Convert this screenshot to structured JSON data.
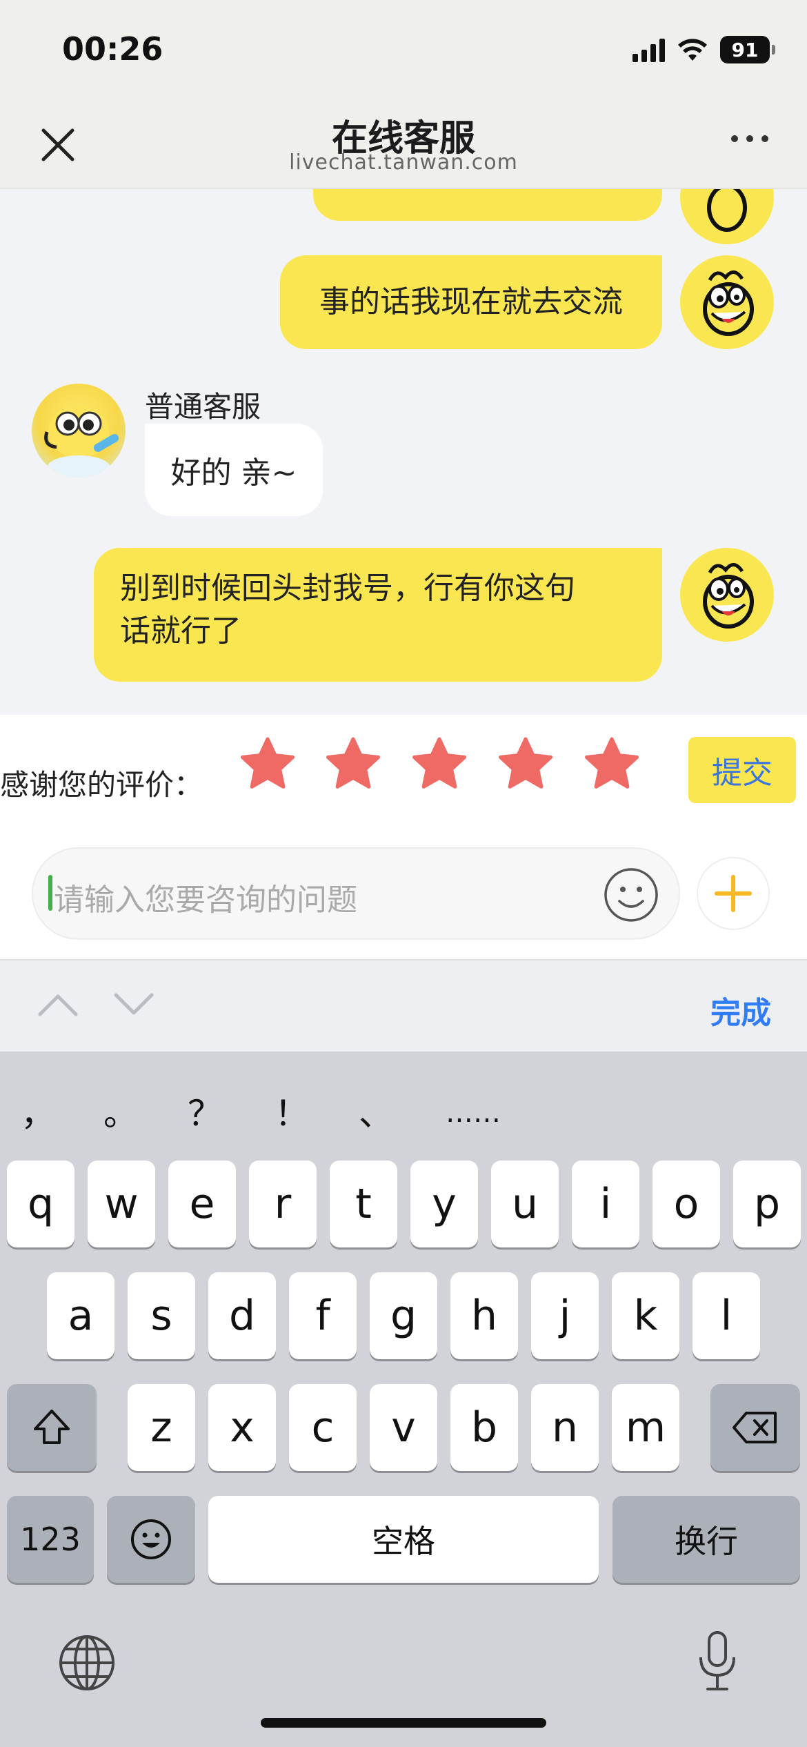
{
  "status_bar": {
    "time": "00:26",
    "battery": "91"
  },
  "header": {
    "title": "在线客服",
    "subtitle": "livechat.tanwan.com"
  },
  "messages": {
    "m0": "事的话我现在就去交流",
    "agent_name": "普通客服",
    "agent_reply": "好的 亲~",
    "m2_line1": "别到时候回头封我号，行有你这句",
    "m2_line2": "话就行了"
  },
  "rating": {
    "label": "感谢您的评价：",
    "stars": 5,
    "max": 5,
    "submit": "提交",
    "star_color": "#ef6a64"
  },
  "composer": {
    "placeholder": "请输入您要咨询的问题"
  },
  "keyboard": {
    "done": "完成",
    "punct": [
      "，",
      "。",
      "？",
      "！",
      "、",
      "……"
    ],
    "row1": [
      "q",
      "w",
      "e",
      "r",
      "t",
      "y",
      "u",
      "i",
      "o",
      "p"
    ],
    "row2": [
      "a",
      "s",
      "d",
      "f",
      "g",
      "h",
      "j",
      "k",
      "l"
    ],
    "row3": [
      "z",
      "x",
      "c",
      "v",
      "b",
      "n",
      "m"
    ],
    "num": "123",
    "space": "空格",
    "return": "换行"
  },
  "colors": {
    "accent_yellow": "#fae650",
    "link_blue": "#2f7cf6"
  }
}
